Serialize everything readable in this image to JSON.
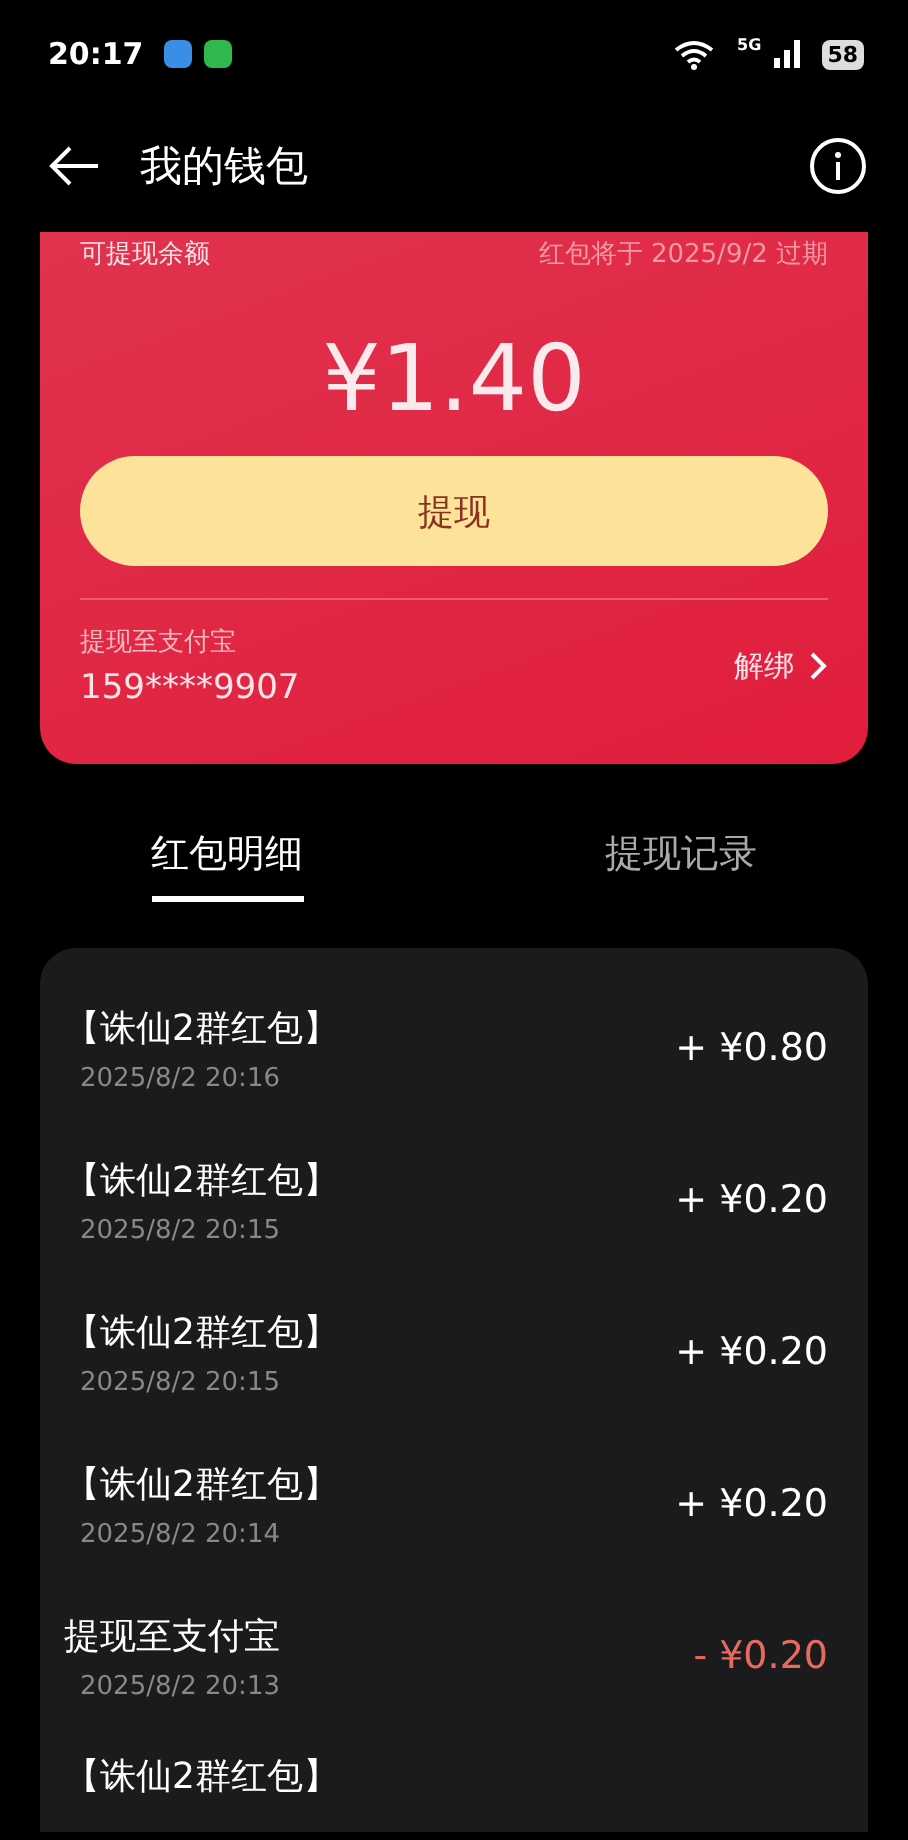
{
  "status_bar": {
    "time": "20:17",
    "network": "5G",
    "battery": "58"
  },
  "header": {
    "title": "我的钱包"
  },
  "balance_card": {
    "label": "可提现余额",
    "expiry": "红包将于 2025/9/2 过期",
    "amount": "¥1.40",
    "withdraw_button": "提现",
    "account_label": "提现至支付宝",
    "account": "159****9907",
    "unbind": "解绑"
  },
  "tabs": [
    {
      "label": "红包明细",
      "selected": true
    },
    {
      "label": "提现记录",
      "selected": false
    }
  ],
  "transactions": [
    {
      "kind": "income",
      "title": "【诛仙2群红包】",
      "time": "2025/8/2 20:16",
      "amount": "+ ¥0.80"
    },
    {
      "kind": "income",
      "title": "【诛仙2群红包】",
      "time": "2025/8/2 20:15",
      "amount": "+ ¥0.20"
    },
    {
      "kind": "income",
      "title": "【诛仙2群红包】",
      "time": "2025/8/2 20:15",
      "amount": "+ ¥0.20"
    },
    {
      "kind": "income",
      "title": "【诛仙2群红包】",
      "time": "2025/8/2 20:14",
      "amount": "+ ¥0.20"
    },
    {
      "kind": "withdraw",
      "title": "提现至支付宝",
      "time": "2025/8/2 20:13",
      "amount": "- ¥0.20"
    },
    {
      "title": "【诛仙2群红包】"
    }
  ]
}
